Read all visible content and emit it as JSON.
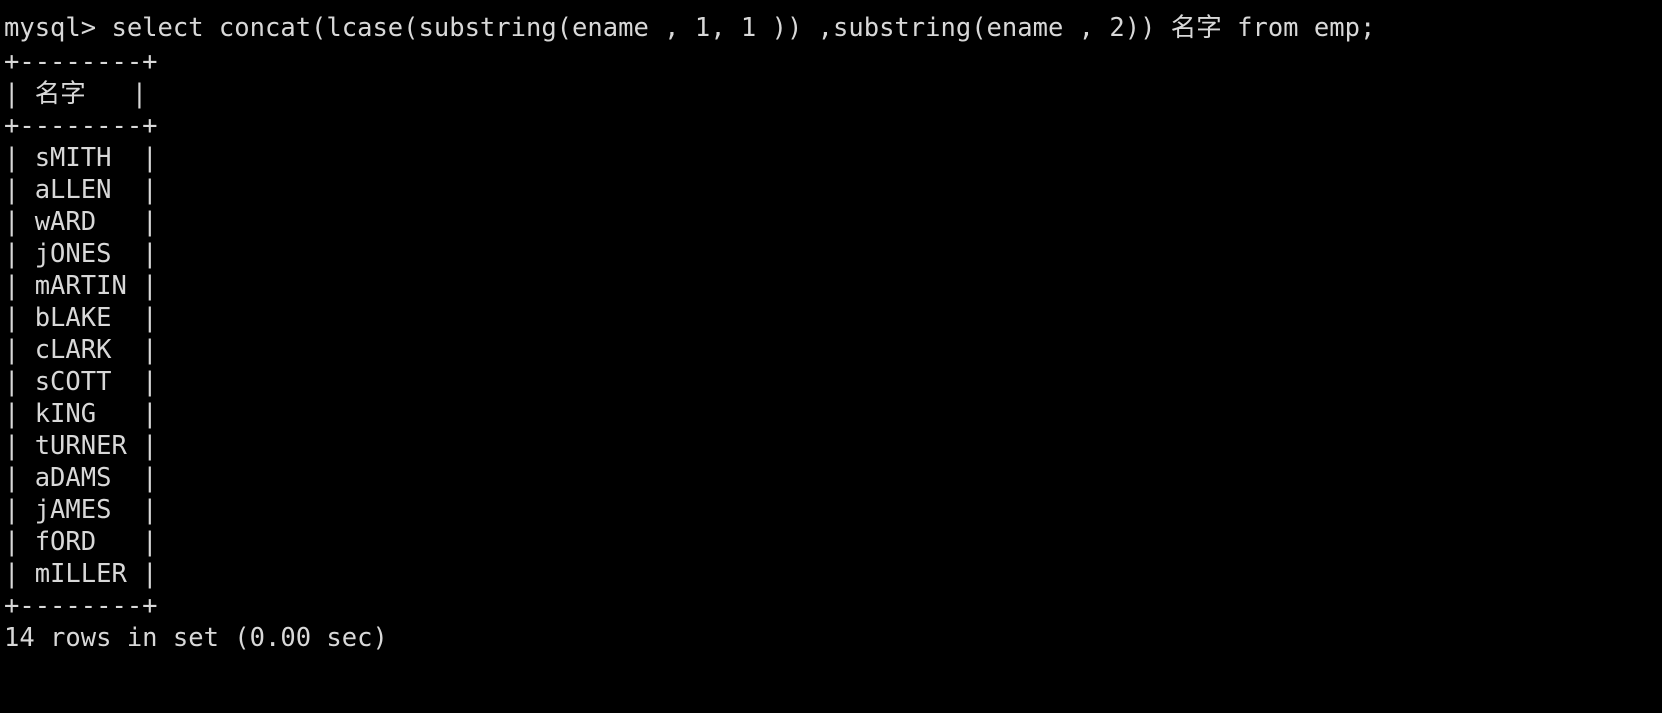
{
  "terminal": {
    "title": "mysql-client-terminal",
    "background_color": "#000000",
    "text_color": "#d8d8d8",
    "prompt": "mysql> ",
    "command": "select concat(lcase(substring(ename , 1, 1 )) ,substring(ename , 2)) 名字 from emp;",
    "command_line": "mysql> select concat(lcase(substring(ename , 1, 1 )) ,substring(ename , 2)) 名字 from emp;",
    "table": {
      "rule": "+--------+",
      "header_row": "| 名字   |",
      "column_header": "名字",
      "rows": [
        "| sMITH  |",
        "| aLLEN  |",
        "| wARD   |",
        "| jONES  |",
        "| mARTIN |",
        "| bLAKE  |",
        "| cLARK  |",
        "| sCOTT  |",
        "| kING   |",
        "| tURNER |",
        "| aDAMS  |",
        "| jAMES  |",
        "| fORD   |",
        "| mILLER |"
      ],
      "values": [
        "sMITH",
        "aLLEN",
        "wARD",
        "jONES",
        "mARTIN",
        "bLAKE",
        "cLARK",
        "sCOTT",
        "kING",
        "tURNER",
        "aDAMS",
        "jAMES",
        "fORD",
        "mILLER"
      ]
    },
    "status_line": "14 rows in set (0.00 sec)",
    "row_count": 14,
    "elapsed": "0.00 sec"
  }
}
